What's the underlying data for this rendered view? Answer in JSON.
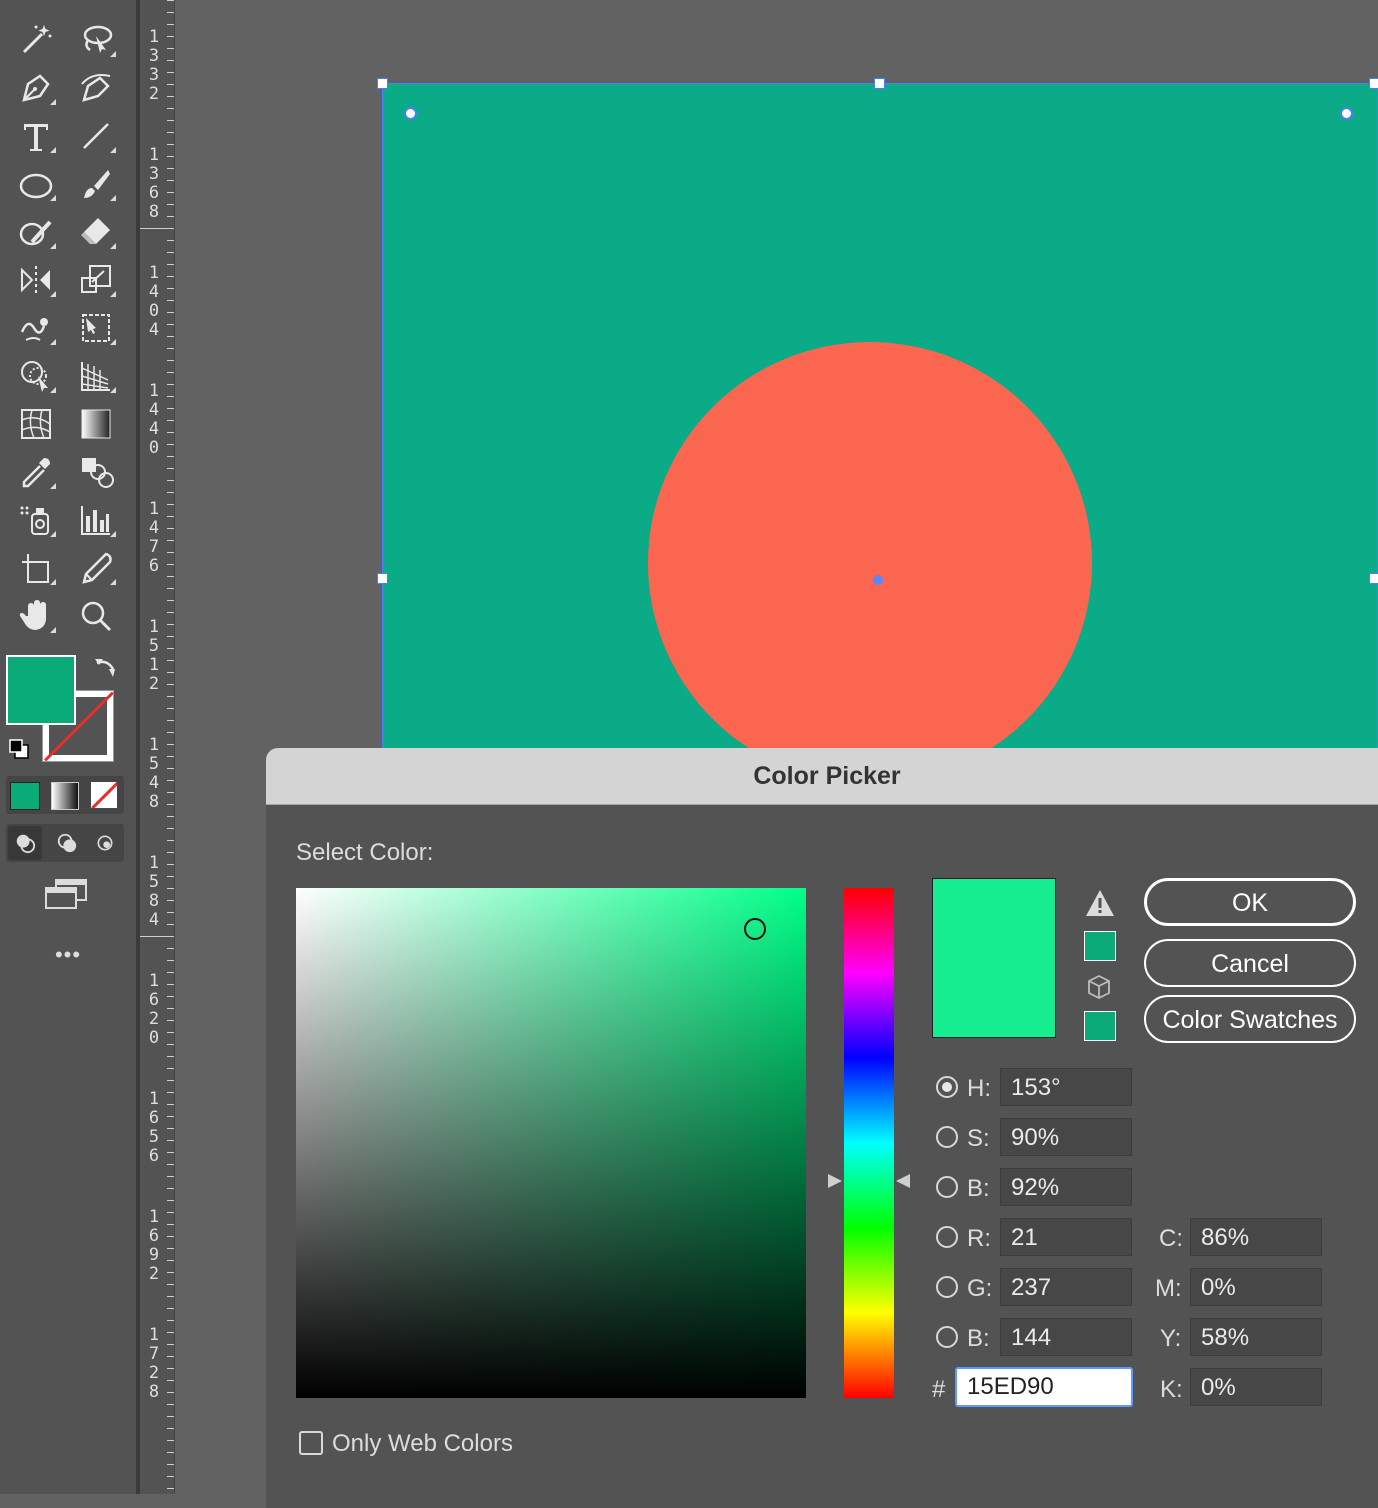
{
  "toolbar": {
    "tools": [
      {
        "name": "magic-wand-icon"
      },
      {
        "name": "lasso-icon"
      },
      {
        "name": "pen-icon"
      },
      {
        "name": "curvature-icon"
      },
      {
        "name": "type-icon"
      },
      {
        "name": "line-segment-icon"
      },
      {
        "name": "ellipse-icon"
      },
      {
        "name": "paintbrush-icon"
      },
      {
        "name": "shaper-icon"
      },
      {
        "name": "eraser-icon"
      },
      {
        "name": "reflect-icon"
      },
      {
        "name": "scale-icon"
      },
      {
        "name": "warp-icon"
      },
      {
        "name": "free-transform-icon"
      },
      {
        "name": "shape-builder-icon"
      },
      {
        "name": "perspective-grid-icon"
      },
      {
        "name": "mesh-icon"
      },
      {
        "name": "gradient-icon"
      },
      {
        "name": "eyedropper-icon"
      },
      {
        "name": "blend-icon"
      },
      {
        "name": "symbol-sprayer-icon"
      },
      {
        "name": "column-graph-icon"
      },
      {
        "name": "artboard-icon"
      },
      {
        "name": "slice-icon"
      },
      {
        "name": "hand-icon"
      },
      {
        "name": "zoom-icon"
      }
    ],
    "fill_color": "#0aab76",
    "more_label": "•••"
  },
  "ruler": {
    "labels": [
      "1332",
      "1368",
      "1404",
      "1440",
      "1476",
      "1512",
      "1548",
      "1584",
      "1620",
      "1656",
      "1692",
      "1728"
    ]
  },
  "canvas": {
    "artboard_color": "#0aab86",
    "circle_color": "#fb6650",
    "selection_color": "#4a7dff"
  },
  "dialog": {
    "title": "Color Picker",
    "select_color_label": "Select Color:",
    "buttons": {
      "ok": "OK",
      "cancel": "Cancel",
      "swatches": "Color Swatches"
    },
    "new_color": "#15ed90",
    "current_color": "#0aab76",
    "fields": {
      "h": {
        "label": "H:",
        "value": "153°",
        "selected": true
      },
      "s": {
        "label": "S:",
        "value": "90%"
      },
      "b": {
        "label": "B:",
        "value": "92%"
      },
      "r": {
        "label": "R:",
        "value": "21"
      },
      "g": {
        "label": "G:",
        "value": "237"
      },
      "b2": {
        "label": "B:",
        "value": "144"
      },
      "c": {
        "label": "C:",
        "value": "86%"
      },
      "m": {
        "label": "M:",
        "value": "0%"
      },
      "y": {
        "label": "Y:",
        "value": "58%"
      },
      "k": {
        "label": "K:",
        "value": "0%"
      },
      "hex": {
        "label": "#",
        "value": "15ED90"
      }
    },
    "only_web_colors": "Only Web Colors",
    "hue_value": 153
  }
}
